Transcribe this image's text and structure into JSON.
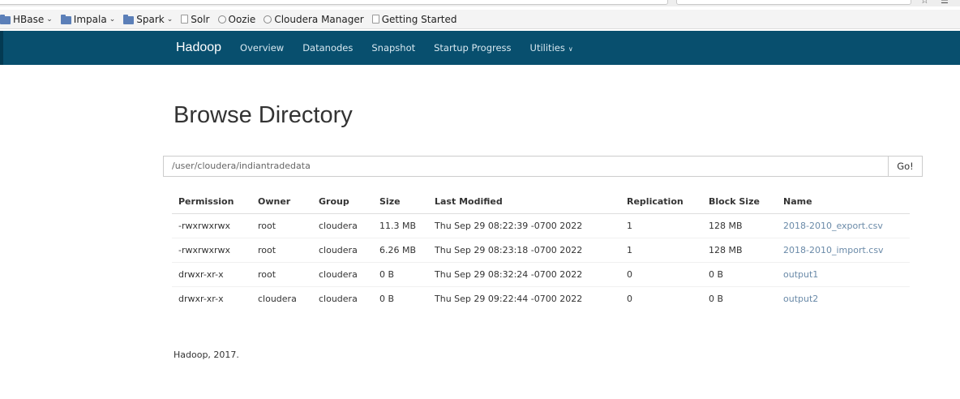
{
  "bookmarks": [
    {
      "label": "HBase",
      "icon": "folder-icon",
      "dropdown": true
    },
    {
      "label": "Impala",
      "icon": "folder-icon",
      "dropdown": true
    },
    {
      "label": "Spark",
      "icon": "folder-icon",
      "dropdown": true
    },
    {
      "label": "Solr",
      "icon": "page-icon",
      "dropdown": false
    },
    {
      "label": "Oozie",
      "icon": "globe-icon",
      "dropdown": false
    },
    {
      "label": "Cloudera Manager",
      "icon": "globe-icon",
      "dropdown": false
    },
    {
      "label": "Getting Started",
      "icon": "page-icon",
      "dropdown": false
    }
  ],
  "navbar": {
    "brand": "Hadoop",
    "links": [
      "Overview",
      "Datanodes",
      "Snapshot",
      "Startup Progress",
      "Utilities"
    ],
    "color": "#084f6e"
  },
  "page": {
    "title": "Browse Directory",
    "path_value": "/user/cloudera/indiantradedata",
    "go_label": "Go!"
  },
  "table": {
    "headers": [
      "Permission",
      "Owner",
      "Group",
      "Size",
      "Last Modified",
      "Replication",
      "Block Size",
      "Name"
    ],
    "rows": [
      [
        "-rwxrwxrwx",
        "root",
        "cloudera",
        "11.3 MB",
        "Thu Sep 29 08:22:39 -0700 2022",
        "1",
        "128 MB",
        "2018-2010_export.csv"
      ],
      [
        "-rwxrwxrwx",
        "root",
        "cloudera",
        "6.26 MB",
        "Thu Sep 29 08:23:18 -0700 2022",
        "1",
        "128 MB",
        "2018-2010_import.csv"
      ],
      [
        "drwxr-xr-x",
        "root",
        "cloudera",
        "0 B",
        "Thu Sep 29 08:32:24 -0700 2022",
        "0",
        "0 B",
        "output1"
      ],
      [
        "drwxr-xr-x",
        "cloudera",
        "cloudera",
        "0 B",
        "Thu Sep 29 09:22:44 -0700 2022",
        "0",
        "0 B",
        "output2"
      ]
    ]
  },
  "footer": "Hadoop, 2017."
}
